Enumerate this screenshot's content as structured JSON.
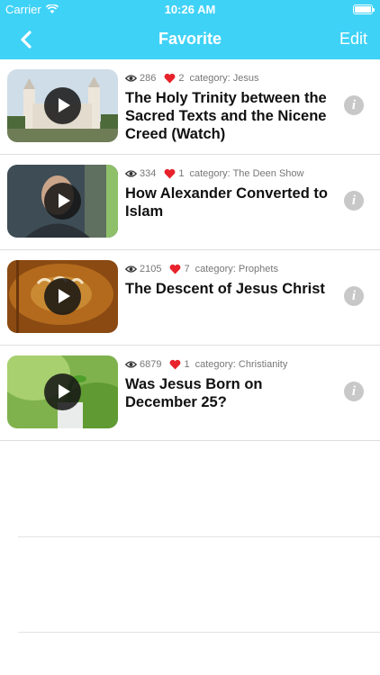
{
  "status": {
    "carrier": "Carrier",
    "time": "10:26 AM"
  },
  "nav": {
    "title": "Favorite",
    "edit_label": "Edit"
  },
  "colors": {
    "accent": "#3fd2f7",
    "heart": "#e8222b"
  },
  "videos": [
    {
      "views": "286",
      "likes": "2",
      "category": "category: Jesus",
      "title": "The Holy Trinity between the Sacred Texts and the Nicene Creed (Watch)"
    },
    {
      "views": "334",
      "likes": "1",
      "category": "category: The Deen Show",
      "title": "How Alexander Converted to Islam"
    },
    {
      "views": "2105",
      "likes": "7",
      "category": "category: Prophets",
      "title": "The Descent of Jesus Christ"
    },
    {
      "views": "6879",
      "likes": "1",
      "category": "category: Christianity",
      "title": "Was Jesus Born on December 25?"
    }
  ],
  "icons": {
    "eye": "eye-icon",
    "heart": "heart-icon",
    "info": "info-icon",
    "play": "play-icon",
    "back": "chevron-left-icon"
  },
  "info_glyph": "i"
}
